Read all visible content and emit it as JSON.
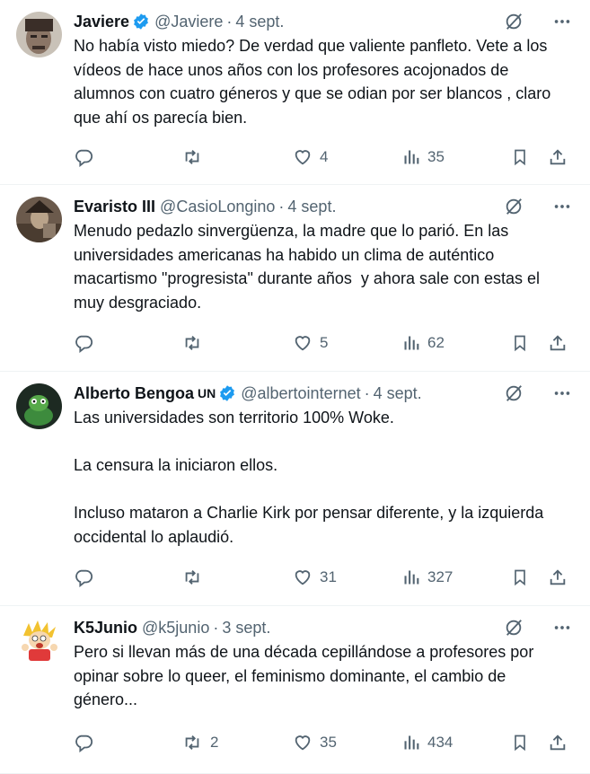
{
  "tweets": [
    {
      "name": "Javiere",
      "affiliation": "",
      "verified": true,
      "handle": "@Javiere",
      "date": "4 sept.",
      "text": "No había visto miedo? De verdad que valiente panfleto. Vete a los vídeos de hace unos años con los profesores acojonados de alumnos con cuatro géneros y que se odian por ser blancos , claro que ahí os parecía bien.",
      "replies": "",
      "reposts": "",
      "likes": "4",
      "views": "35"
    },
    {
      "name": "Evaristo III",
      "affiliation": "",
      "verified": false,
      "handle": "@CasioLongino",
      "date": "4 sept.",
      "text": "Menudo pedazlo sinvergüenza, la madre que lo parió. En las universidades americanas ha habido un clima de auténtico macartismo \"progresista\" durante años  y ahora sale con estas el muy desgraciado.",
      "replies": "",
      "reposts": "",
      "likes": "5",
      "views": "62"
    },
    {
      "name": "Alberto Bengoa",
      "affiliation": "UN",
      "verified": true,
      "handle": "@albertointernet",
      "date": "4 sept.",
      "text": "Las universidades son territorio 100% Woke.\n\nLa censura la iniciaron ellos.\n\nIncluso mataron a Charlie Kirk por pensar diferente, y la izquierda occidental lo aplaudió.",
      "replies": "",
      "reposts": "",
      "likes": "31",
      "views": "327"
    },
    {
      "name": "K5Junio",
      "affiliation": "",
      "verified": false,
      "handle": "@k5junio",
      "date": "3 sept.",
      "text": "Pero si llevan más de una década cepillándose a profesores por opinar sobre lo queer, el feminismo dominante, el cambio de género...",
      "replies": "",
      "reposts": "2",
      "likes": "35",
      "views": "434"
    }
  ],
  "icons": {
    "reply": "reply-icon",
    "repost": "repost-icon",
    "like": "like-icon",
    "views": "views-icon",
    "bookmark": "bookmark-icon",
    "share": "share-icon",
    "grok": "grok-icon",
    "more": "more-icon",
    "verified": "verified-badge-icon"
  },
  "colors": {
    "text": "#0f1419",
    "secondary": "#536471",
    "verified": "#1d9bf0",
    "divider": "#eff3f4"
  }
}
